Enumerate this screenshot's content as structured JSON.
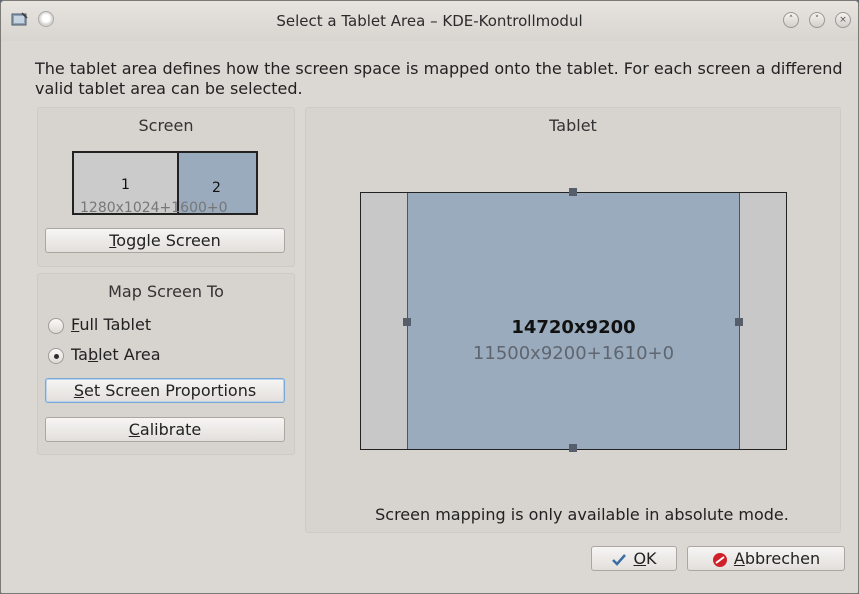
{
  "window": {
    "title": "Select a Tablet Area – KDE-Kontrollmodul"
  },
  "intro_text": "The tablet area defines how the screen space is mapped onto the tablet. For each screen a differend valid tablet area can be selected.",
  "screen_group": {
    "title": "Screen",
    "screen1_number": "1",
    "screen2_number": "2",
    "geometry_text": "1280x1024+1600+0",
    "toggle_button": {
      "mnemonic": "T",
      "rest": "oggle Screen"
    }
  },
  "map_group": {
    "title": "Map Screen To",
    "full_tablet": {
      "mnemonic": "F",
      "rest": "ull Tablet",
      "selected": false
    },
    "tablet_area": {
      "prefix": "Ta",
      "mnemonic": "b",
      "rest": "let Area",
      "selected": true
    },
    "set_proportions_button": {
      "mnemonic": "S",
      "rest": "et Screen Proportions"
    },
    "calibrate_button": {
      "mnemonic": "C",
      "rest": "alibrate"
    }
  },
  "tablet_group": {
    "title": "Tablet",
    "full_size": "14720x9200",
    "area_geometry": "11500x9200+1610+0",
    "note": "Screen mapping is only available in absolute mode."
  },
  "footer": {
    "ok_button": {
      "mnemonic": "O",
      "rest": "K"
    },
    "cancel_button": {
      "mnemonic": "A",
      "rest": "bbrechen"
    }
  },
  "colors": {
    "window_bg": "#dbd7d2",
    "screen_selected": "#9aabbd",
    "tablet_unused": "#c8c8c8",
    "cancel_icon": "#d0202a",
    "ok_icon": "#3a6ea5"
  }
}
